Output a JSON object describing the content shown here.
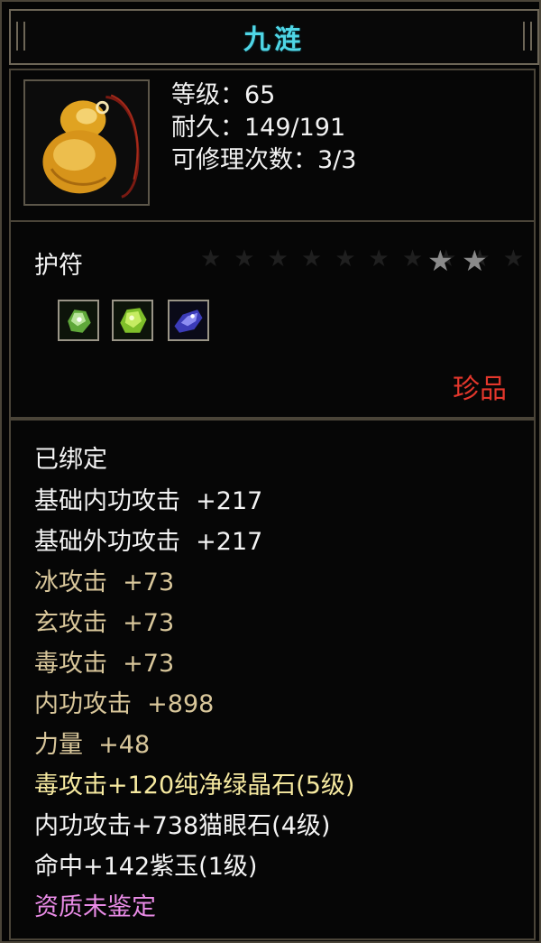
{
  "window": {
    "title": "九涟"
  },
  "item": {
    "icon": "amber-gourd-pendant-icon",
    "level_label": "等级：65",
    "durability_label": "耐久：149/191",
    "repair_label": "可修理次数：3/3",
    "type": "护符",
    "star_count": 2,
    "gems": [
      "green-gem-icon",
      "lime-gem-icon",
      "purple-gem-icon"
    ],
    "rarity": "珍品"
  },
  "stats": {
    "bound": "已绑定",
    "lines": [
      {
        "text": "基础内功攻击  +217",
        "color": "white"
      },
      {
        "text": "基础外功攻击  +217",
        "color": "white"
      },
      {
        "text": "冰攻击  +73",
        "color": "tan"
      },
      {
        "text": "玄攻击  +73",
        "color": "tan"
      },
      {
        "text": "毒攻击  +73",
        "color": "tan"
      },
      {
        "text": "内功攻击  +898",
        "color": "tan"
      },
      {
        "text": "力量  +48",
        "color": "tan"
      },
      {
        "text": "毒攻击+120纯净绿晶石(5级)",
        "color": "yellow"
      },
      {
        "text": "内功攻击+738猫眼石(4级)",
        "color": "white"
      },
      {
        "text": "命中+142紫玉(1级)",
        "color": "white"
      },
      {
        "text": "资质未鉴定",
        "color": "pink"
      }
    ]
  },
  "colors": {
    "title": "#4fd6e6",
    "rarity": "#e3372c",
    "tan": "#d9c79b",
    "yellow": "#f6e9a0",
    "pink": "#e98be6"
  }
}
